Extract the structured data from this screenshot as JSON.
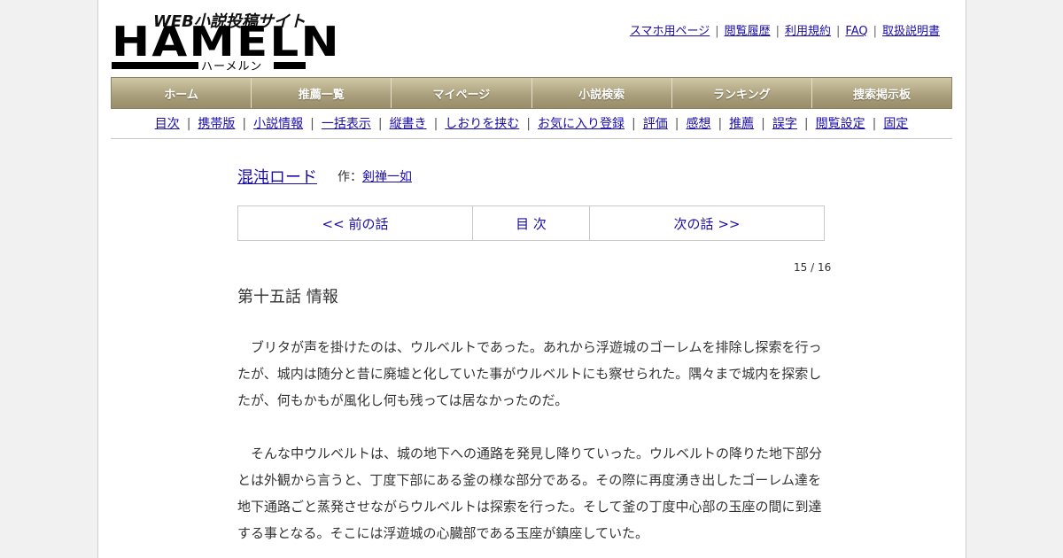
{
  "logo": {
    "tagline": "WEB小説投稿サイト",
    "name": "HAMELN",
    "kana": "ハーメルン"
  },
  "top_links": [
    "スマホ用ページ",
    "閲覧履歴",
    "利用規約",
    "FAQ",
    "取扱説明書"
  ],
  "main_nav": [
    "ホーム",
    "推薦一覧",
    "マイページ",
    "小説検索",
    "ランキング",
    "捜索掲示板"
  ],
  "sub_nav": [
    "目次",
    "携帯版",
    "小説情報",
    "一括表示",
    "縦書き",
    "しおりを挟む",
    "お気に入り登録",
    "評価",
    "感想",
    "推薦",
    "誤字",
    "閲覧設定",
    "固定"
  ],
  "novel": {
    "title": "混沌ロード",
    "author_prefix": "作：",
    "author": "剣禅一如"
  },
  "chapter_nav": {
    "prev": "<< 前の話",
    "toc": "目 次",
    "next": "次の話 >>"
  },
  "page_count": "15 / 16",
  "chapter_title": "第十五話 情報",
  "paragraphs": [
    "　ブリタが声を掛けたのは、ウルベルトであった。あれから浮遊城のゴーレムを排除し探索を行ったが、城内は随分と昔に廃墟と化していた事がウルベルトにも察せられた。隅々まで城内を探索したが、何もかもが風化し何も残っては居なかったのだ。",
    "　そんな中ウルベルトは、城の地下への通路を発見し降りていった。ウルベルトの降りた地下部分とは外観から言うと、丁度下部にある釜の様な部分である。その際に再度湧き出したゴーレム達を地下通路ごと蒸発させながらウルベルトは探索を行った。そして釜の丁度中心部の玉座の間に到達する事となる。そこには浮遊城の心臓部である玉座が鎮座していた。"
  ]
}
